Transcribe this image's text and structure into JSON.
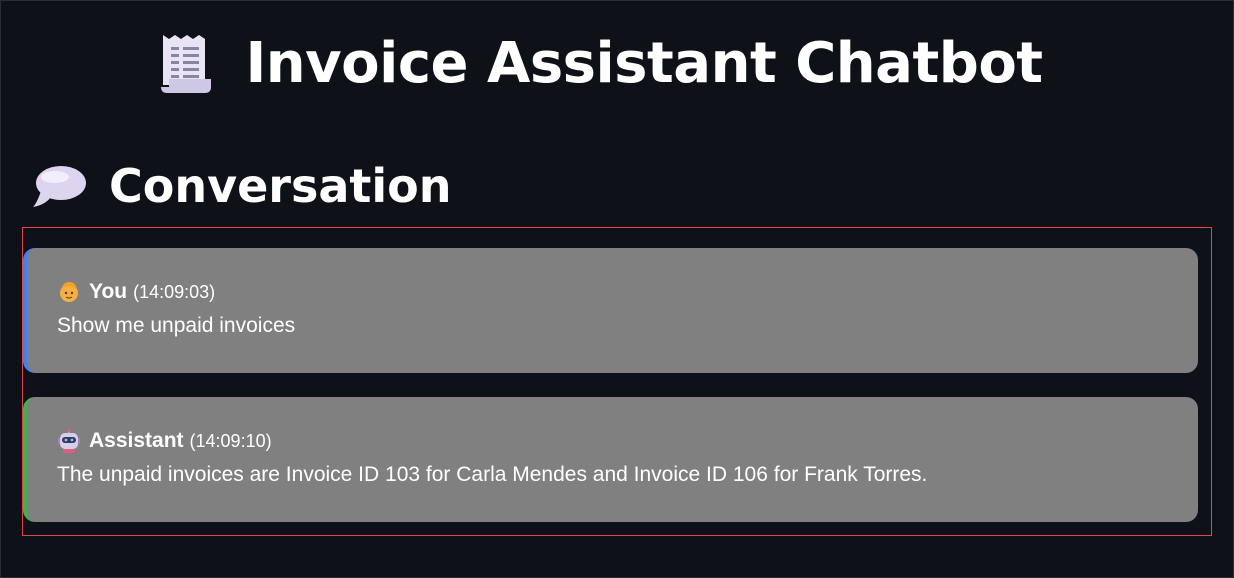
{
  "header": {
    "title": "Invoice Assistant Chatbot",
    "icon": "receipt-icon"
  },
  "section": {
    "title": "Conversation",
    "icon": "speech-bubble-icon"
  },
  "messages": [
    {
      "role": "user",
      "sender": "You",
      "time": "(14:09:03)",
      "text": "Show me unpaid invoices",
      "avatar": "person-icon",
      "accent": "#3b82f6"
    },
    {
      "role": "assistant",
      "sender": "Assistant",
      "time": "(14:09:10)",
      "text": "The unpaid invoices are Invoice ID 103 for Carla Mendes and Invoice ID 106 for Frank Torres.",
      "avatar": "robot-icon",
      "accent": "#3fb24f"
    }
  ],
  "colors": {
    "background": "#0e1117",
    "message_bg": "#808080",
    "highlight_border": "#e0474c"
  }
}
